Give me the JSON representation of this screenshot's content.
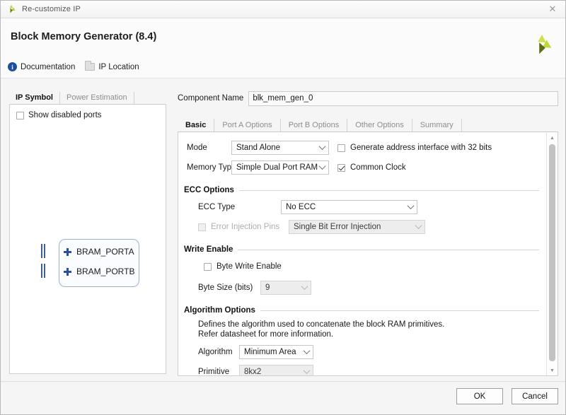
{
  "window": {
    "titlebar_text": "Re-customize IP",
    "close_label": "✕",
    "app_icon": "xilinx-logo-icon"
  },
  "header": {
    "title": "Block Memory Generator (8.4)",
    "logo": "xilinx-logo-icon",
    "links": [
      {
        "label": "Documentation",
        "icon": "info-icon"
      },
      {
        "label": "IP Location",
        "icon": "folder-icon"
      }
    ]
  },
  "left_panel": {
    "tabs": [
      {
        "label": "IP Symbol",
        "active": true
      },
      {
        "label": "Power Estimation",
        "active": false
      }
    ],
    "show_disabled_ports": {
      "label": "Show disabled ports",
      "checked": false
    },
    "symbol": {
      "ports": [
        {
          "label": "BRAM_PORTA",
          "expander": "plus-icon"
        },
        {
          "label": "BRAM_PORTB",
          "expander": "plus-icon"
        }
      ]
    }
  },
  "right_panel": {
    "component_name": {
      "label": "Component Name",
      "value": "blk_mem_gen_0",
      "placeholder": "blk_mem_gen_0"
    },
    "tabs": [
      {
        "label": "Basic",
        "active": true
      },
      {
        "label": "Port A Options",
        "active": false
      },
      {
        "label": "Port B Options",
        "active": false
      },
      {
        "label": "Other Options",
        "active": false
      },
      {
        "label": "Summary",
        "active": false
      }
    ],
    "basic": {
      "mode": {
        "label": "Mode",
        "value": "Stand Alone"
      },
      "memory_type": {
        "label": "Memory Type",
        "value": "Simple Dual Port RAM"
      },
      "generate_address_interface": {
        "label": "Generate address interface with 32 bits",
        "checked": false
      },
      "common_clock": {
        "label": "Common Clock",
        "checked": true
      },
      "ecc_options": {
        "title": "ECC Options",
        "ecc_type": {
          "label": "ECC Type",
          "value": "No ECC",
          "disabled": false
        },
        "error_injection_pins": {
          "label": "Error Injection Pins",
          "checked": false,
          "disabled": true,
          "value": "Single Bit Error Injection"
        }
      },
      "write_enable": {
        "title": "Write Enable",
        "byte_write_enable": {
          "label": "Byte Write Enable",
          "checked": false
        },
        "byte_size": {
          "label": "Byte Size (bits)",
          "value": "9",
          "disabled": true
        }
      },
      "algorithm_options": {
        "title": "Algorithm Options",
        "description_line1": "Defines the algorithm used to concatenate the block RAM primitives.",
        "description_line2": "Refer datasheet for more information.",
        "algorithm": {
          "label": "Algorithm",
          "value": "Minimum Area",
          "disabled": false
        },
        "primitive": {
          "label": "Primitive",
          "value": "8kx2",
          "disabled": true
        }
      }
    },
    "scrollbar": {
      "up_arrow": "chevron-up-icon",
      "down_arrow": "chevron-down-icon"
    }
  },
  "footer": {
    "ok_label": "OK",
    "cancel_label": "Cancel"
  },
  "colors": {
    "accent_blue": "#2b4f9e",
    "logo_green": "#9fc01e",
    "dialog_bg": "#f5f5f5",
    "panel_bg": "#ffffff"
  }
}
